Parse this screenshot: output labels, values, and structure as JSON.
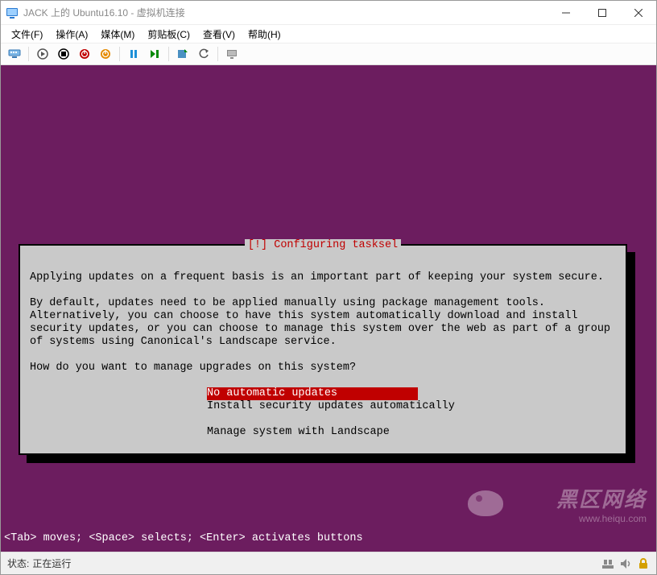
{
  "titlebar": {
    "text": "JACK 上的 Ubuntu16.10 - 虚拟机连接"
  },
  "menubar": {
    "file": "文件(F)",
    "action": "操作(A)",
    "media": "媒体(M)",
    "clipboard": "剪贴板(C)",
    "view": "查看(V)",
    "help": "帮助(H)"
  },
  "dialog": {
    "title": "[!] Configuring tasksel",
    "line1": "Applying updates on a frequent basis is an important part of keeping your system secure.",
    "line2": "By default, updates need to be applied manually using package management tools.",
    "line3": "Alternatively, you can choose to have this system automatically download and install",
    "line4": "security updates, or you can choose to manage this system over the web as part of a group",
    "line5": "of systems using Canonical's Landscape service.",
    "prompt": "How do you want to manage upgrades on this system?",
    "options": [
      "No automatic updates",
      "Install security updates automatically",
      "Manage system with Landscape"
    ],
    "selected_index": 0
  },
  "hint": "<Tab> moves; <Space> selects; <Enter> activates buttons",
  "statusbar": {
    "label": "状态:",
    "value": "正在运行"
  },
  "watermark": {
    "text": "黑区网络",
    "url": "www.heiqu.com"
  }
}
